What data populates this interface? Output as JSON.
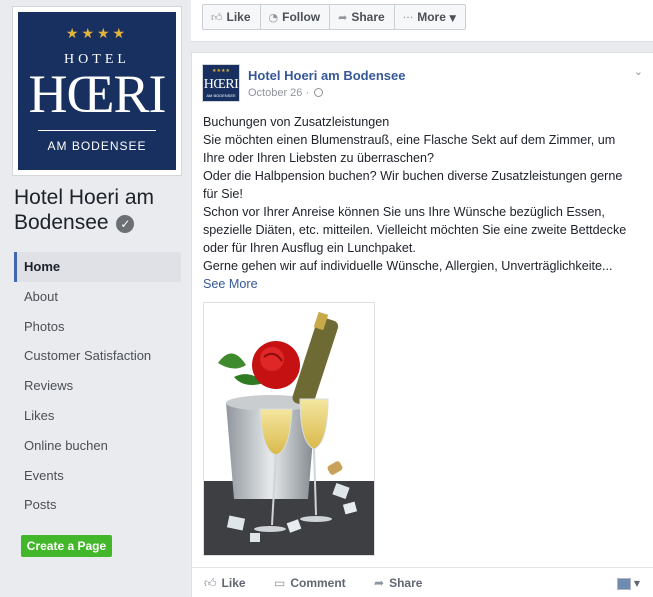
{
  "page": {
    "logo": {
      "stars": "★★★★",
      "line1": "HOTEL",
      "line2": "HŒRI",
      "line3": "AM BODENSEE"
    },
    "name": "Hotel Hoeri am Bodensee",
    "verified_icon": "verified-badge-icon"
  },
  "nav": {
    "items": [
      {
        "label": "Home",
        "active": true
      },
      {
        "label": "About"
      },
      {
        "label": "Photos"
      },
      {
        "label": "Customer Satisfaction"
      },
      {
        "label": "Reviews"
      },
      {
        "label": "Likes"
      },
      {
        "label": "Online buchen"
      },
      {
        "label": "Events"
      },
      {
        "label": "Posts"
      }
    ],
    "create_page_label": "Create a Page"
  },
  "actionbar": {
    "like_label": "Like",
    "follow_label": "Follow",
    "share_label": "Share",
    "more_label": "More"
  },
  "post": {
    "author": "Hotel Hoeri am Bodensee",
    "date": "October 26",
    "lines": [
      "Buchungen von Zusatzleistungen",
      "Sie möchten einen Blumenstrauß, eine Flasche Sekt auf dem Zimmer, um",
      "Ihre oder Ihren Liebsten zu überraschen?",
      "Oder die Halbpension buchen? Wir buchen diverse Zusatzleistungen gerne",
      "für Sie!",
      "Schon vor Ihrer Anreise können Sie uns Ihre Wünsche bezüglich Essen,",
      "spezielle Diäten, etc. mitteilen. Vielleicht möchten Sie eine zweite Bettdecke",
      "oder für Ihren Ausflug ein Lunchpaket.",
      "Gerne gehen wir auf individuelle Wünsche, Allergien, Unverträglichkeite..."
    ],
    "see_more": "See More",
    "footer": {
      "like_label": "Like",
      "comment_label": "Comment",
      "share_label": "Share"
    }
  },
  "colors": {
    "brand_navy": "#17305f",
    "link_blue": "#365899",
    "create_green": "#42b72a",
    "star_gold": "#e3b43c"
  }
}
